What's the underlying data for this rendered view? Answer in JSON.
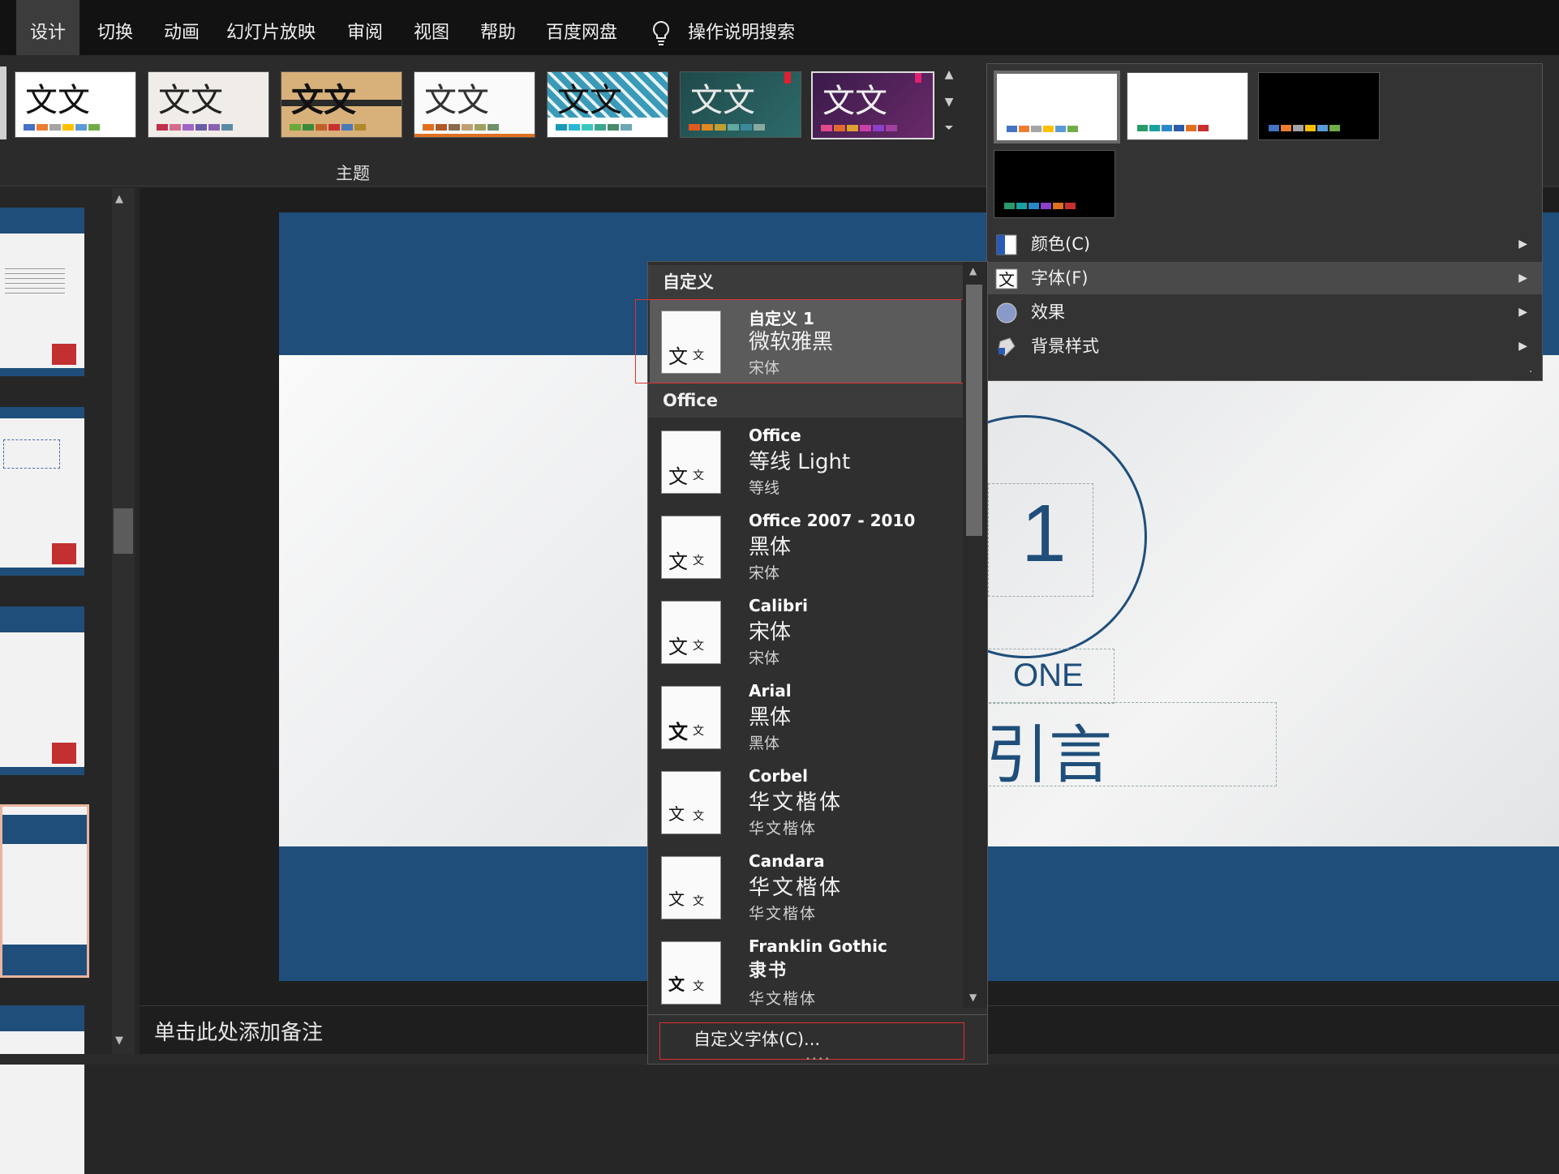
{
  "ribbon": {
    "tabs": [
      "设计",
      "切换",
      "动画",
      "幻灯片放映",
      "审阅",
      "视图",
      "帮助",
      "百度网盘"
    ],
    "active_tab": "设计",
    "search_label": "操作说明搜索",
    "themes_group_label": "主题",
    "theme_thumb_text": "文文"
  },
  "variants_menu": {
    "items": [
      {
        "label": "颜色(C)",
        "icon": "color-palette-icon"
      },
      {
        "label": "字体(F)",
        "icon": "font-wen-icon"
      },
      {
        "label": "效果",
        "icon": "effects-circle-icon"
      },
      {
        "label": "背景样式",
        "icon": "background-style-icon"
      }
    ]
  },
  "font_menu": {
    "custom_header": "自定义",
    "custom_item": {
      "name": "自定义 1",
      "heading_font": "微软雅黑",
      "body_font": "宋体"
    },
    "office_header": "Office",
    "office_items": [
      {
        "name": "Office",
        "heading_font": "等线 Light",
        "body_font": "等线"
      },
      {
        "name": "Office 2007 - 2010",
        "heading_font": "黑体",
        "body_font": "宋体"
      },
      {
        "name": "Calibri",
        "heading_font": "宋体",
        "body_font": "宋体"
      },
      {
        "name": "Arial",
        "heading_font": "黑体",
        "body_font": "黑体"
      },
      {
        "name": "Corbel",
        "heading_font": "华文楷体",
        "body_font": "华文楷体"
      },
      {
        "name": "Candara",
        "heading_font": "华文楷体",
        "body_font": "华文楷体"
      },
      {
        "name": "Franklin Gothic",
        "heading_font": "隶书",
        "body_font": "华文楷体"
      }
    ],
    "preview_big": "文",
    "preview_small": "文",
    "customize_fonts": "自定义字体(C)..."
  },
  "slide": {
    "section_number_partial": "1",
    "subtitle_partial": "ONE",
    "title_partial": "引言"
  },
  "notes": {
    "placeholder": "单击此处添加备注"
  },
  "colors": {
    "slide_blue": "#1f4e7a",
    "ribbon_bg": "#2b2b2b",
    "menu_bg": "#2f2f2f",
    "highlight_box": "#e03030",
    "thumb_selected_border": "#e8b4a0"
  }
}
